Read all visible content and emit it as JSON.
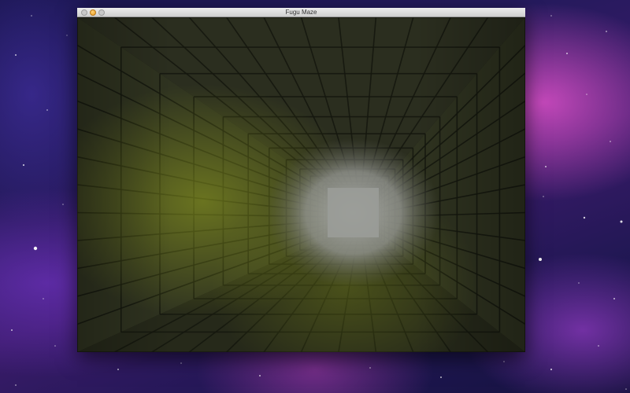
{
  "window": {
    "title": "Fugu Maze"
  },
  "scene": {
    "wall_color": "#2f3320",
    "floor_color": "#26291a",
    "ceiling_color": "#2b2e1f",
    "highlight_color": "#8a9a20",
    "fog_color": "#9a9c98"
  }
}
